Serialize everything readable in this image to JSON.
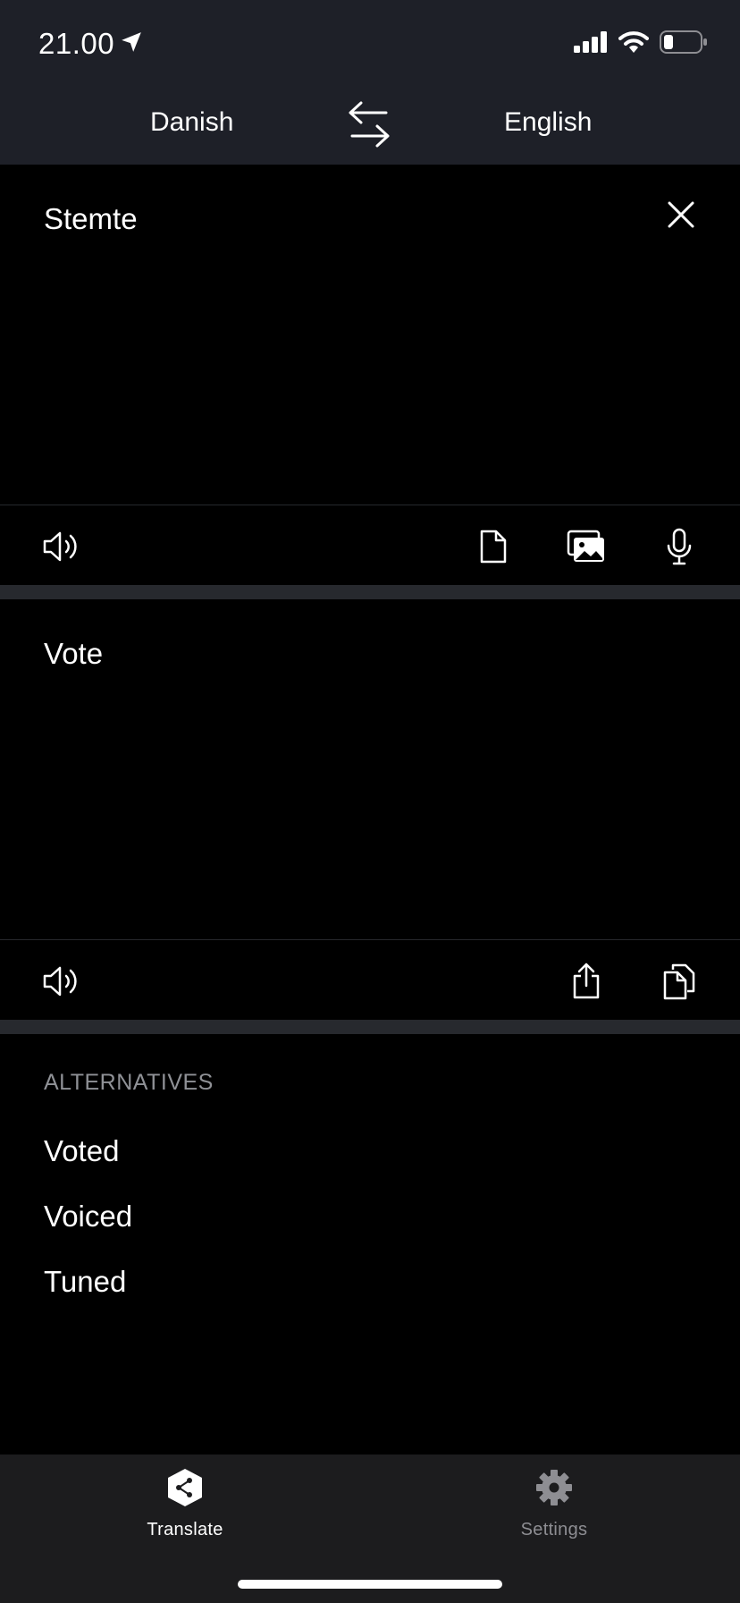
{
  "status_bar": {
    "time": "21.00"
  },
  "header": {
    "source_language": "Danish",
    "target_language": "English"
  },
  "source_panel": {
    "text": "Stemte"
  },
  "target_panel": {
    "text": "Vote"
  },
  "alternatives": {
    "heading": "ALTERNATIVES",
    "items": [
      "Voted",
      "Voiced",
      "Tuned"
    ]
  },
  "tab_bar": {
    "tabs": [
      {
        "label": "Translate",
        "active": true
      },
      {
        "label": "Settings",
        "active": false
      }
    ]
  },
  "colors": {
    "header_bg": "#1e2028",
    "separator": "#27292e",
    "tabbar_bg": "#1c1c1e",
    "muted_text": "#8f9196"
  }
}
